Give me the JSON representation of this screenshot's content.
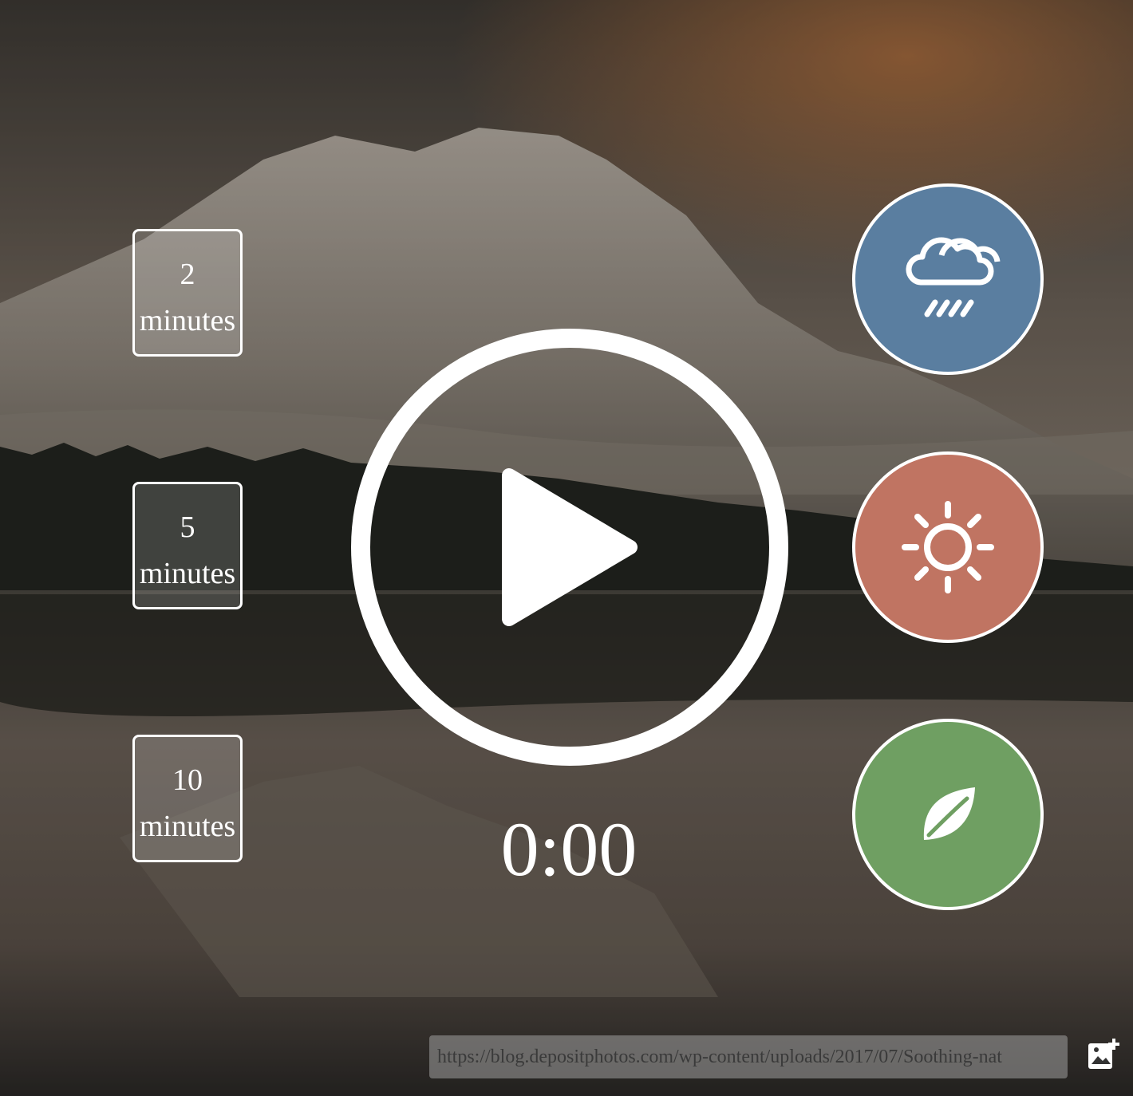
{
  "durations": [
    {
      "number": "2",
      "unit": "minutes"
    },
    {
      "number": "5",
      "unit": "minutes"
    },
    {
      "number": "10",
      "unit": "minutes"
    }
  ],
  "player": {
    "timer": "0:00",
    "play_icon": "play-icon"
  },
  "sounds": [
    {
      "icon": "rain-cloud-icon",
      "color": "#5a7ea0"
    },
    {
      "icon": "sun-icon",
      "color": "#c07462"
    },
    {
      "icon": "leaf-icon",
      "color": "#6f9f62"
    }
  ],
  "background_url": {
    "value": "https://blog.depositphotos.com/wp-content/uploads/2017/07/Soothing-nat"
  },
  "add_image_icon": "add-image-icon"
}
